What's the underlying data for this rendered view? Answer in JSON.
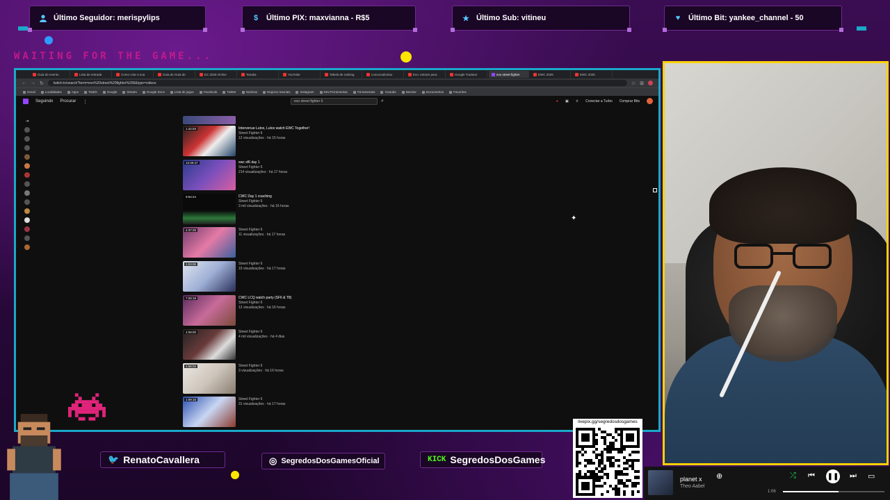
{
  "alerts": [
    {
      "icon": "user-icon",
      "text": "Último Seguidor: merispylips"
    },
    {
      "icon": "dollar-icon",
      "text": "Último PIX: maxvianna - R$5"
    },
    {
      "icon": "star-icon",
      "text": "Último Sub: vitineu"
    },
    {
      "icon": "heart-icon",
      "text": "Último Bit: yankee_channel - 50"
    }
  ],
  "waiting_text": "WAITING FOR THE GAME...",
  "browser": {
    "tabs": [
      "Guia de evento",
      "Lista de entrada",
      "Como criar a sua",
      "Guia de Guia de",
      "EC 2025 Online",
      "Tanaka",
      "YouTube",
      "Tabela de ranking",
      "convocados/ao",
      "Evo: entram para",
      "Google Tradutor",
      "evo street fighter",
      "EWC 2025",
      "EWC 2025"
    ],
    "active_tab_index": 11,
    "url": "twitch.tv/search?term=evo%20street%20fighter%206&type=videos",
    "bookmarks": [
      "Gmail",
      "Localidades",
      "Apps",
      "Twitch",
      "Google",
      "Stream",
      "Google Docs",
      "Lista de jogos",
      "Facebook",
      "Twitter",
      "Notícias",
      "Negócio tutoriais",
      "Instagram",
      "Dev.Ferramentas",
      "Ferramentas",
      "Youtube",
      "Monitor",
      "Documentos",
      "Favoritos"
    ],
    "header": {
      "following": "Seguindo",
      "browse": "Procurar",
      "search_value": "evo street fighter 6",
      "connect_label": "Conectar a Turbo",
      "buy_label": "Comprar Bits"
    },
    "videos": [
      {
        "duration": "",
        "title": "",
        "channel": "",
        "game": "",
        "views": ""
      },
      {
        "duration": "1:42:03",
        "title": "Intervenue Lutox, Lutox watch EWC Together!",
        "channel": "",
        "game": "Street Fighter 6",
        "views": "12 visualizações · há 15 horas"
      },
      {
        "duration": "12:30:47",
        "title": "ewc sf6 day 1",
        "channel": "",
        "game": "Street Fighter 6",
        "views": "214 visualizações · há 17 horas"
      },
      {
        "duration": "9:54:24",
        "title": "CWC Day 1 coaching",
        "channel": "",
        "game": "Street Fighter 6",
        "views": "3 mil visualizações · há 16 horas"
      },
      {
        "duration": "4:37:25",
        "title": "",
        "channel": "",
        "game": "Street Fighter 6",
        "views": "11 visualizações · há 17 horas"
      },
      {
        "duration": "1:03:00",
        "title": "",
        "channel": "",
        "game": "Street Fighter 6",
        "views": "15 visualizações · há 17 horas"
      },
      {
        "duration": "7:28:18",
        "title": "CWC LCQ watch party (SF6 & T8)",
        "channel": "",
        "game": "Street Fighter 6",
        "views": "12 visualizações · há 16 horas"
      },
      {
        "duration": "4:08:00",
        "title": "",
        "channel": "",
        "game": "Street Fighter 6",
        "views": "4 mil visualizações · há 4 dias"
      },
      {
        "duration": "1:58:02",
        "title": "",
        "channel": "",
        "game": "Street Fighter 6",
        "views": "3 visualizações · há 16 horas"
      },
      {
        "duration": "1:09:15",
        "title": "",
        "channel": "",
        "game": "Street Fighter 6",
        "views": "31 visualizações · há 17 horas"
      }
    ]
  },
  "socials": [
    {
      "icon": "twitter-icon",
      "name": "RenatoCavallera"
    },
    {
      "icon": "instagram-icon",
      "name": "SegredosDosGamesOficial"
    },
    {
      "icon": "kick-icon",
      "badge": "KICK",
      "name": "SegredosDosGames"
    }
  ],
  "qr": {
    "label": "livepix.gg/segredosdosgames"
  },
  "player": {
    "title": "planet x",
    "artist": "Theo Aabel",
    "time": "1:06",
    "progress": 0.55
  },
  "colors": {
    "accent_cyan": "#1aa9c9",
    "accent_yellow": "#ffd200",
    "waiting_pink": "#d4198c",
    "kick_green": "#53fc18"
  }
}
